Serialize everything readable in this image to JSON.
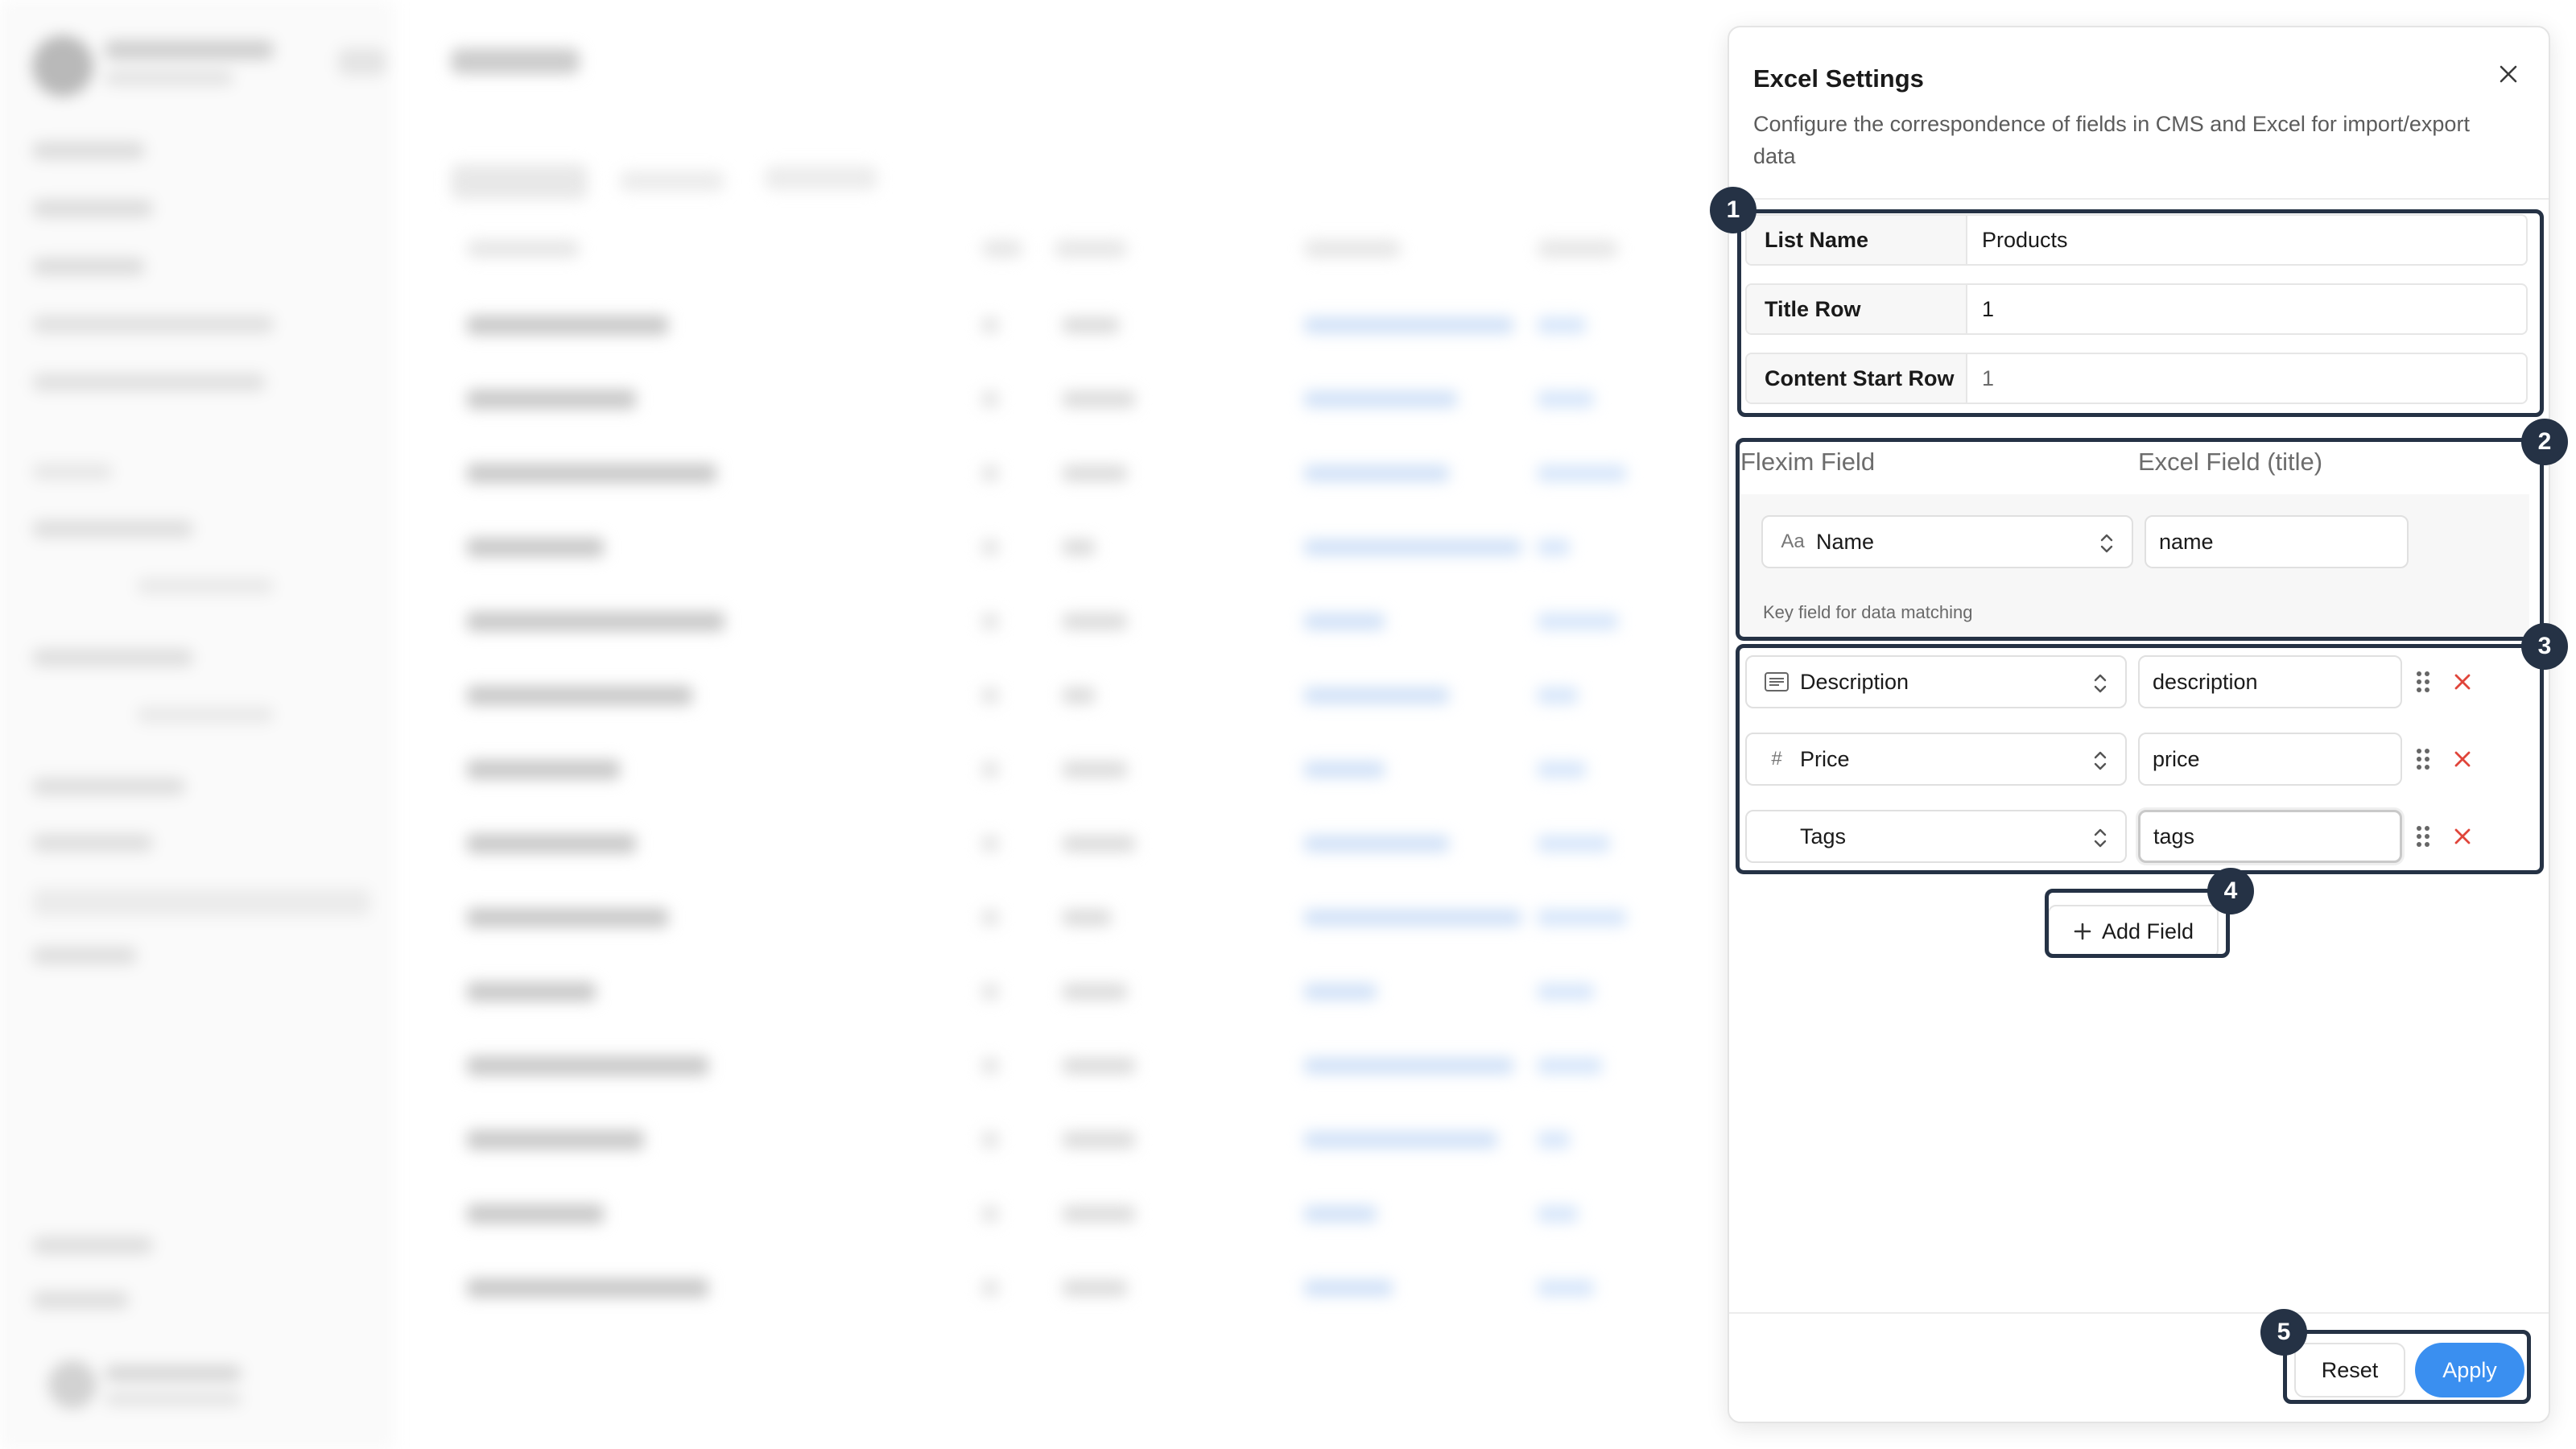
{
  "panel": {
    "title": "Excel Settings",
    "description": "Configure the correspondence of fields in CMS and Excel for import/export data"
  },
  "meta": [
    {
      "label": "List Name",
      "value": "Products"
    },
    {
      "label": "Title Row",
      "value": "1"
    },
    {
      "label": "Content Start Row",
      "value": "1"
    }
  ],
  "mapping": {
    "flexim_header": "Flexim Field",
    "excel_header": "Excel Field (title)",
    "key_field": {
      "icon": "text-type-icon",
      "icon_glyph": "Aa",
      "name": "Name",
      "excel": "name",
      "hint": "Key field for data matching"
    },
    "fields": [
      {
        "icon": "paragraph-icon",
        "name": "Description",
        "excel": "description"
      },
      {
        "icon": "hash-icon",
        "icon_glyph": "#",
        "name": "Price",
        "excel": "price"
      },
      {
        "icon": "",
        "name": "Tags",
        "excel": "tags"
      }
    ]
  },
  "add_field_label": "Add Field",
  "footer": {
    "reset_label": "Reset",
    "apply_label": "Apply"
  },
  "annotations": [
    "1",
    "2",
    "3",
    "4",
    "5"
  ],
  "colors": {
    "accent": "#3a8ff0",
    "delete": "#e0453a",
    "annotation": "#253245"
  }
}
